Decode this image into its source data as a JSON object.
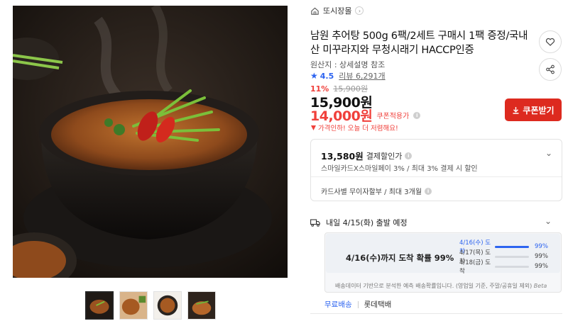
{
  "gallery": {
    "main_alt": "추어탕",
    "thumbnails": 4,
    "active_thumb": 1
  },
  "shop": {
    "name": "또시장몰",
    "chevron": "›"
  },
  "product": {
    "title": "남원 추어탕 500g 6팩/2세트 구매시 1팩 증정/국내산 미꾸라지와 무청시래기 HACCP인증",
    "origin": "원산지 : 상세설명 참조",
    "rating": "4.5",
    "review_label": "리뷰 6,291개"
  },
  "price": {
    "discount_rate": "11%",
    "original": "15,900원",
    "sale": "15,900원",
    "coupon": "14,000원",
    "coupon_label": "쿠폰적용가",
    "drop_notice": "가격인하! 오늘 더 저렴해요!",
    "coupon_button": "쿠폰받기"
  },
  "benefit": {
    "amount": "13,580원",
    "label": "결제할인가",
    "detail": "스마일카드X스마일페이 3% / 최대 3% 결제 시 할인",
    "installment": "카드사별 무이자할부 / 최대 3개월"
  },
  "delivery": {
    "heading": "내일 4/15(화) 출발 예정",
    "probability": "4/16(수)까지 도착 확률 99%",
    "rows": [
      {
        "date": "4/16(수) 도착",
        "pct": "99%",
        "fill": 0.99
      },
      {
        "date": "4/17(목) 도착",
        "pct": "99%",
        "fill": 0
      },
      {
        "date": "4/18(금) 도착",
        "pct": "99%",
        "fill": 0
      }
    ],
    "note": "배송데이터 기반으로 분석한 예측 배송확률입니다. (영업일 기준, 주말/공휴일 제외)",
    "beta": "Beta",
    "tab_free": "무료배송",
    "tab_carrier": "롯데택배"
  },
  "colors": {
    "accent_red": "#dd2a1f",
    "price_red": "#f0403b",
    "accent_blue": "#2d64f0"
  },
  "icons": [
    "home-icon",
    "heart-icon",
    "share-icon",
    "download-icon",
    "star-icon",
    "info-icon",
    "truck-icon",
    "chevron-down-icon",
    "price-drop-icon"
  ]
}
